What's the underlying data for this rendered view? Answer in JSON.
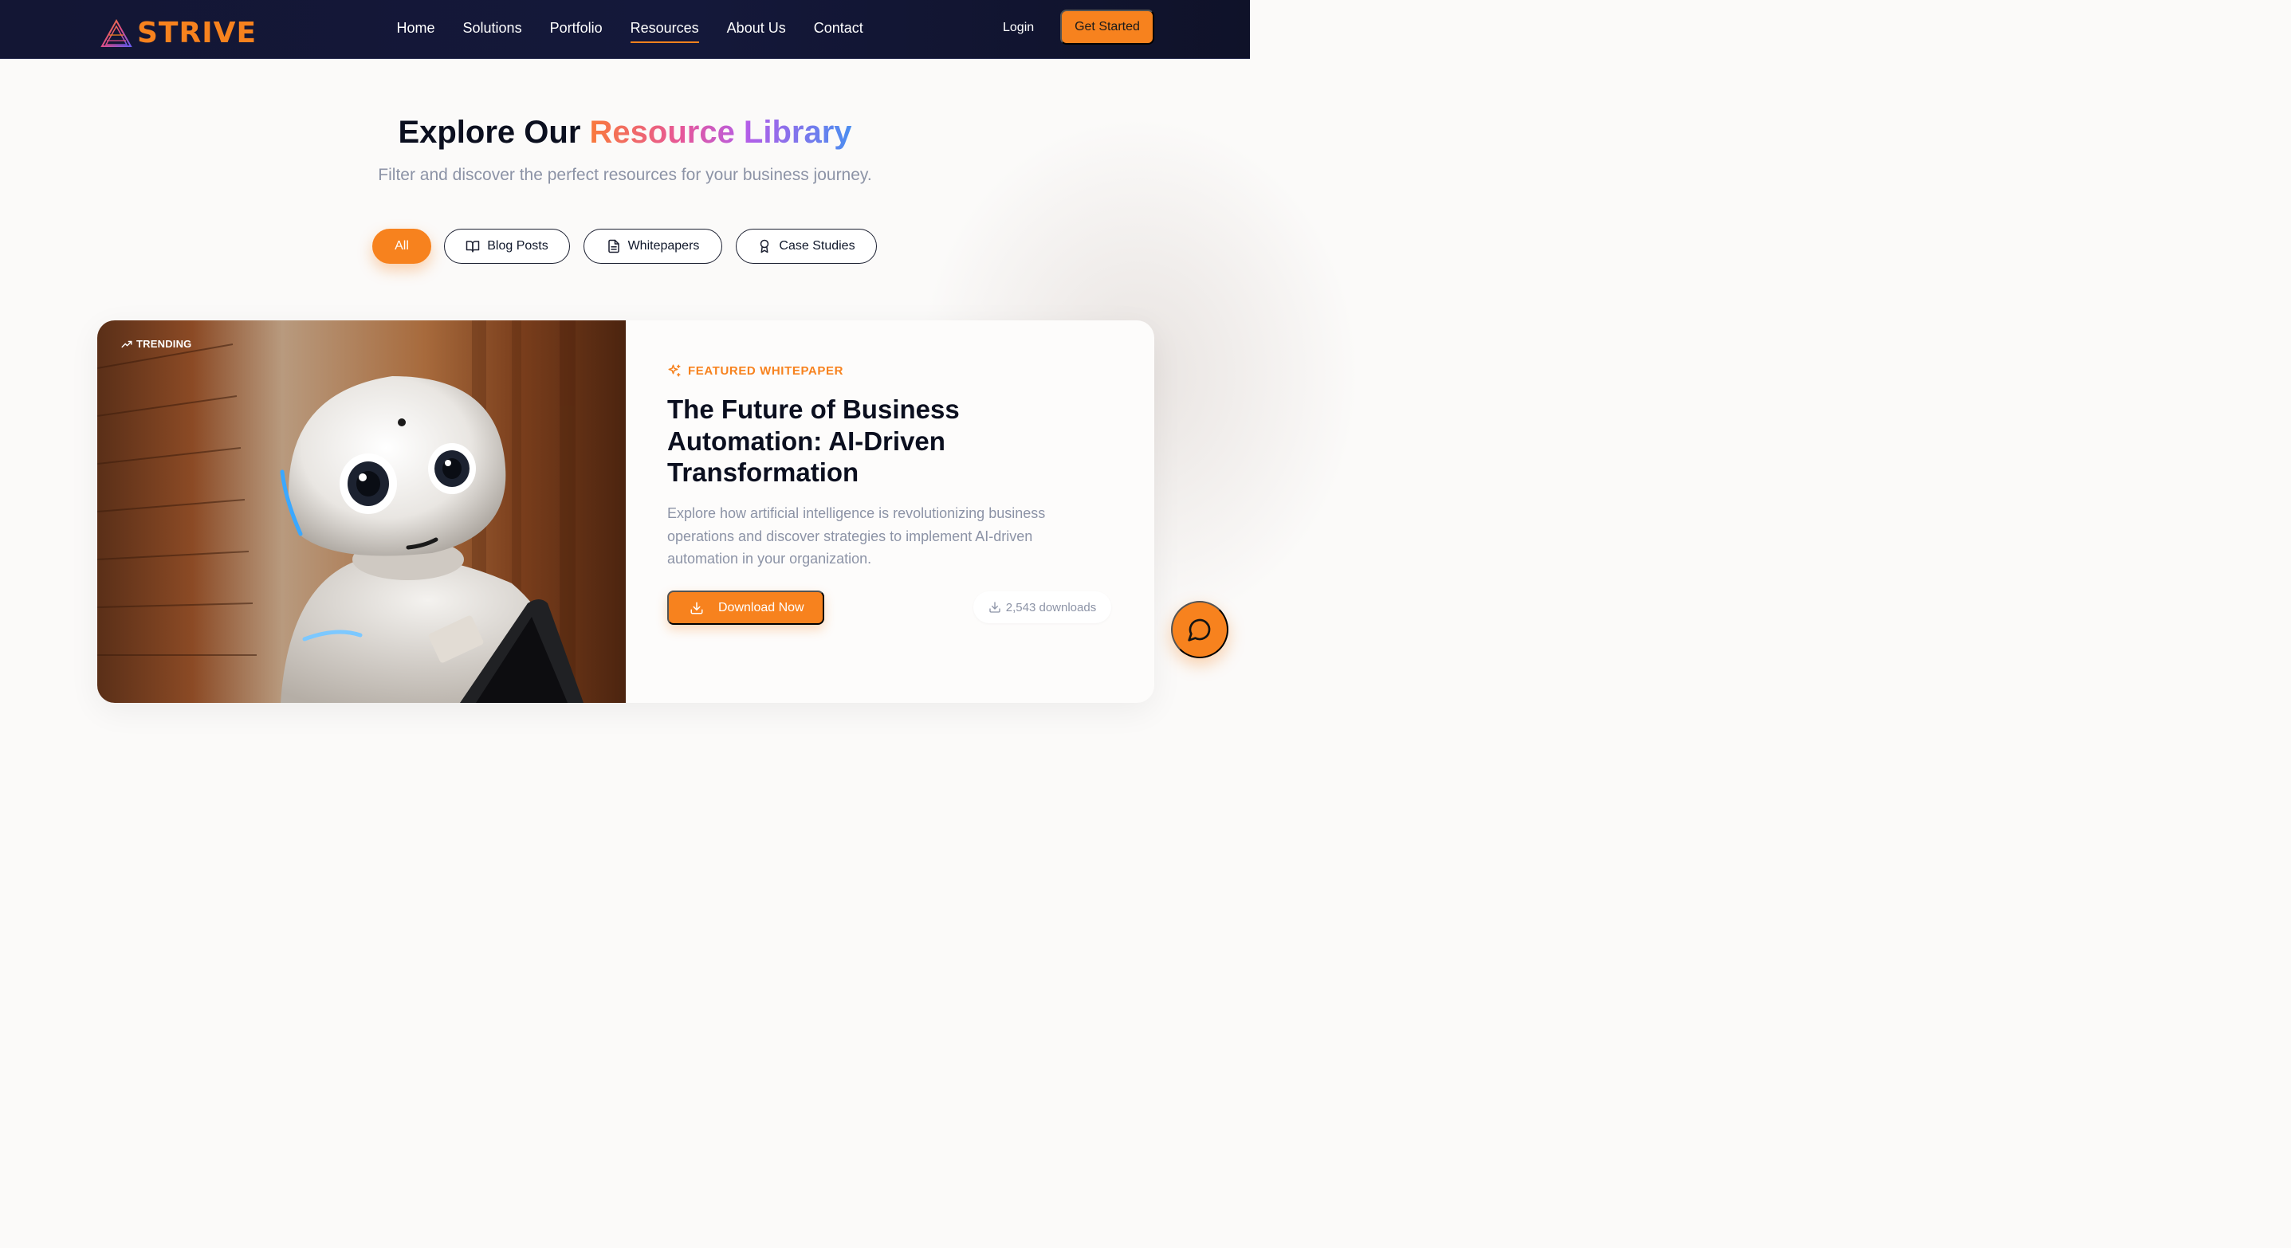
{
  "brand": {
    "name": "STRIVE",
    "color": "#f7821e"
  },
  "nav": {
    "links": [
      "Home",
      "Solutions",
      "Portfolio",
      "Resources",
      "About Us",
      "Contact"
    ],
    "active": "Resources",
    "login_label": "Login",
    "cta_label": "Get Started"
  },
  "hero": {
    "title_prefix": "Explore Our",
    "title_highlight": "Resource Library",
    "subtitle": "Filter and discover the perfect resources for your business journey."
  },
  "filters": [
    {
      "label": "All",
      "icon": null,
      "active": true
    },
    {
      "label": "Blog Posts",
      "icon": "book-open-icon",
      "active": false
    },
    {
      "label": "Whitepapers",
      "icon": "document-icon",
      "active": false
    },
    {
      "label": "Case Studies",
      "icon": "award-icon",
      "active": false
    }
  ],
  "featured": {
    "badge_label": "TRENDING",
    "badge_icon": "trending-up-icon",
    "eyebrow": "FEATURED WHITEPAPER",
    "eyebrow_icon": "sparkles-icon",
    "title": "The Future of Business Automation: AI-Driven Transformation",
    "description": "Explore how artificial intelligence is revolutionizing business operations and discover strategies to implement AI-driven automation in your organization.",
    "download_label": "Download Now",
    "downloads_text": "2,543 downloads",
    "image_alt_subject": "humanoid-robot"
  },
  "chat": {
    "icon": "chat-bubble-icon"
  },
  "colors": {
    "accent": "#f7821e",
    "nav_bg": "#131634",
    "muted_text": "#8c93a6"
  }
}
